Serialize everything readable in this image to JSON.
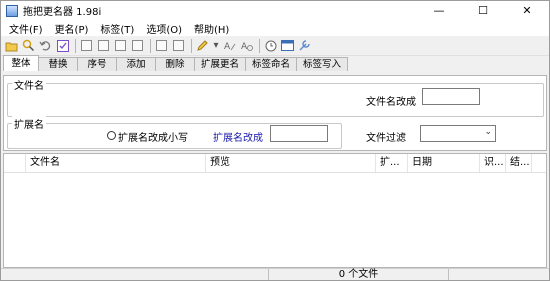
{
  "window": {
    "title": "拖把更名器 1.98i",
    "minimize": "—",
    "maximize": "☐",
    "close": "✕"
  },
  "menu": [
    "文件(F)",
    "更名(P)",
    "标签(T)",
    "选项(O)",
    "帮助(H)"
  ],
  "toolbar": {
    "icons": [
      "open-folder-icon",
      "search-icon",
      "undo-icon",
      "checkbox-icon",
      "copy-icon",
      "paste-icon",
      "copy-2-icon",
      "paste-2-icon",
      "document-icon",
      "document-2-icon",
      "highlighter-icon",
      "dropdown-icon",
      "rename-icon",
      "rename-filter-icon",
      "clock-icon",
      "window-icon",
      "wrench-icon"
    ]
  },
  "tabs": [
    "整体",
    "替换",
    "序号",
    "添加",
    "删除",
    "扩展更名",
    "标签命名",
    "标签写入"
  ],
  "panel": {
    "filename_group": "文件名",
    "filename_case_label": "文件名改成",
    "filename_case_value": "",
    "ext_group": "扩展名",
    "ext_lower_label": "扩展名改成小写",
    "ext_change_label": "扩展名改成",
    "ext_change_value": "",
    "file_filter_label": "文件过滤",
    "file_filter_value": ""
  },
  "list": {
    "columns": [
      "文件名",
      "预览",
      "扩...",
      "日期",
      "识...",
      "结..."
    ]
  },
  "status": {
    "left": "",
    "count": "0 个文件",
    "right": ""
  },
  "colors": {
    "ext_change_label": "#1a1aa8"
  }
}
